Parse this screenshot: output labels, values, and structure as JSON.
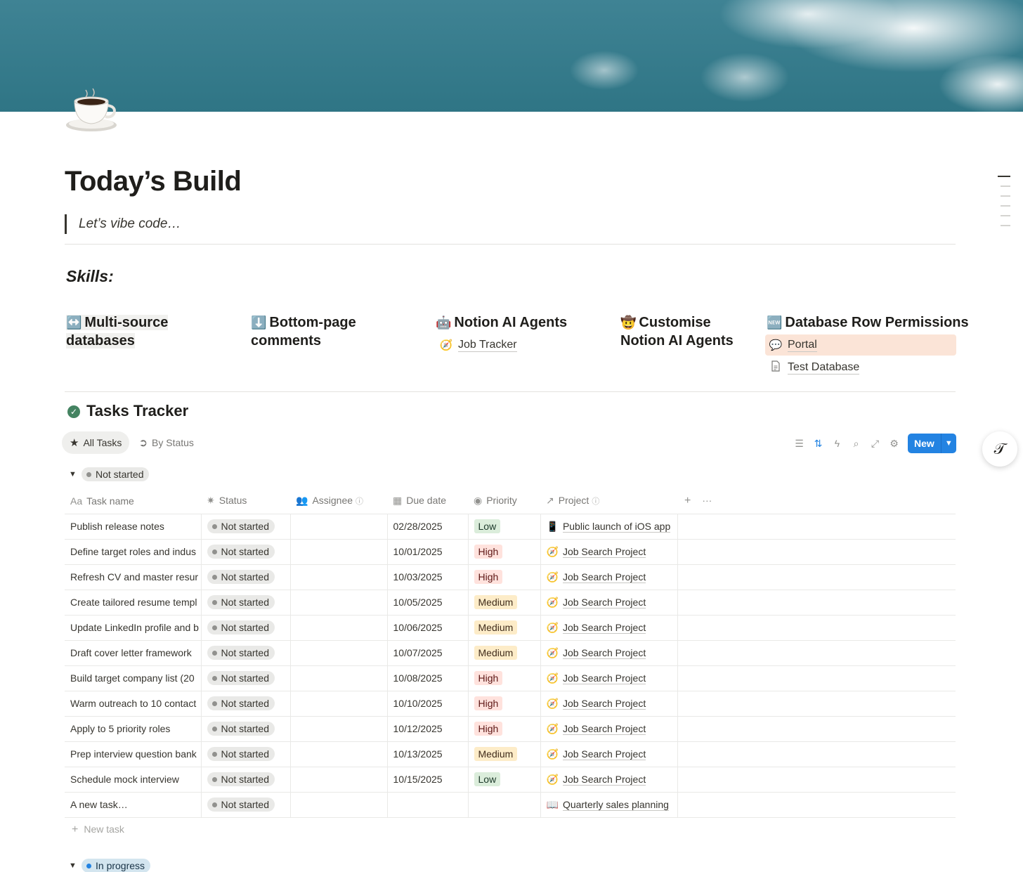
{
  "page": {
    "title": "Today’s Build",
    "quote": "Let’s vibe code…",
    "icon": "coffee-cup-icon"
  },
  "skills": {
    "heading": "Skills:",
    "columns": [
      {
        "emoji": "↔️",
        "title": "Multi-source databases",
        "links": []
      },
      {
        "emoji": "⬇️",
        "title": "Bottom-page comments",
        "links": []
      },
      {
        "emoji": "🤖",
        "title": "Notion AI Agents",
        "links": [
          {
            "emoji": "🧭",
            "label": "Job Tracker"
          }
        ]
      },
      {
        "emoji": "🤠",
        "title": "Customise Notion AI Agents",
        "links": []
      },
      {
        "emoji": "🆕",
        "title": "Database Row Permissions",
        "links": [
          {
            "emoji": "💬",
            "label": "Portal"
          },
          {
            "emoji": "📄",
            "label": "Test Database"
          }
        ]
      }
    ]
  },
  "tracker": {
    "title": "Tasks Tracker",
    "views": [
      {
        "label": "All Tasks",
        "icon": "star-icon"
      },
      {
        "label": "By Status",
        "icon": "arrow-circle-icon"
      }
    ],
    "new_button": "New",
    "columns": {
      "name": "Task name",
      "status": "Status",
      "assignee": "Assignee",
      "due": "Due date",
      "priority": "Priority",
      "project": "Project"
    },
    "groups": [
      {
        "label": "Not started",
        "color": "#91918e"
      },
      {
        "label": "In progress",
        "color": "#2383e2"
      }
    ],
    "rows": [
      {
        "name": "Publish release notes",
        "status": "Not started",
        "due": "02/28/2025",
        "priority": "Low",
        "project": "Public launch of iOS app",
        "project_emoji": "📱"
      },
      {
        "name": "Define target roles and indus",
        "status": "Not started",
        "due": "10/01/2025",
        "priority": "High",
        "project": "Job Search Project",
        "project_emoji": "🧭"
      },
      {
        "name": "Refresh CV and master resur",
        "status": "Not started",
        "due": "10/03/2025",
        "priority": "High",
        "project": "Job Search Project",
        "project_emoji": "🧭"
      },
      {
        "name": "Create tailored resume templ",
        "status": "Not started",
        "due": "10/05/2025",
        "priority": "Medium",
        "project": "Job Search Project",
        "project_emoji": "🧭"
      },
      {
        "name": "Update LinkedIn profile and b",
        "status": "Not started",
        "due": "10/06/2025",
        "priority": "Medium",
        "project": "Job Search Project",
        "project_emoji": "🧭"
      },
      {
        "name": "Draft cover letter framework",
        "status": "Not started",
        "due": "10/07/2025",
        "priority": "Medium",
        "project": "Job Search Project",
        "project_emoji": "🧭"
      },
      {
        "name": "Build target company list (20",
        "status": "Not started",
        "due": "10/08/2025",
        "priority": "High",
        "project": "Job Search Project",
        "project_emoji": "🧭"
      },
      {
        "name": "Warm outreach to 10 contact",
        "status": "Not started",
        "due": "10/10/2025",
        "priority": "High",
        "project": "Job Search Project",
        "project_emoji": "🧭"
      },
      {
        "name": "Apply to 5 priority roles",
        "status": "Not started",
        "due": "10/12/2025",
        "priority": "High",
        "project": "Job Search Project",
        "project_emoji": "🧭"
      },
      {
        "name": "Prep interview question bank",
        "status": "Not started",
        "due": "10/13/2025",
        "priority": "Medium",
        "project": "Job Search Project",
        "project_emoji": "🧭"
      },
      {
        "name": "Schedule mock interview",
        "status": "Not started",
        "due": "10/15/2025",
        "priority": "Low",
        "project": "Job Search Project",
        "project_emoji": "🧭"
      },
      {
        "name": "A new task…",
        "status": "Not started",
        "due": "",
        "priority": "",
        "project": "Quarterly sales planning",
        "project_emoji": "📖"
      }
    ],
    "new_task_label": "New task"
  }
}
